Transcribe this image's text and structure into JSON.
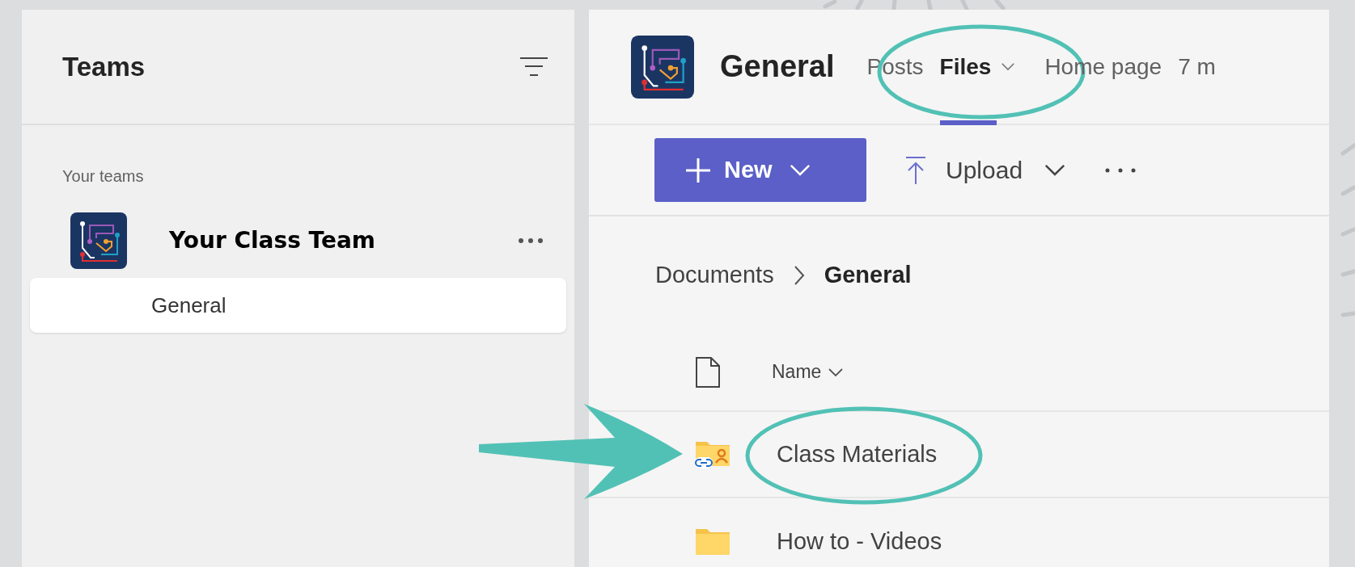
{
  "sidebar": {
    "title": "Teams",
    "section_label": "Your teams",
    "teams": [
      {
        "name": "Your Class Team",
        "channels": [
          {
            "name": "General",
            "selected": true
          }
        ]
      }
    ]
  },
  "channel": {
    "title": "General",
    "tabs": [
      {
        "label": "Posts",
        "selected": false,
        "dropdown": false,
        "circled": false
      },
      {
        "label": "Files",
        "selected": true,
        "dropdown": true,
        "circled": true
      },
      {
        "label": "Home page",
        "selected": false,
        "dropdown": false,
        "circled": false
      },
      {
        "label": "7 m",
        "selected": false,
        "dropdown": false,
        "circled": false
      }
    ]
  },
  "toolbar": {
    "new_label": "New",
    "upload_label": "Upload"
  },
  "breadcrumb": [
    {
      "label": "Documents",
      "current": false
    },
    {
      "label": "General",
      "current": true
    }
  ],
  "file_list": {
    "name_column": "Name",
    "rows": [
      {
        "name": "Class Materials",
        "kind": "shared-folder",
        "circled": true,
        "arrow": true
      },
      {
        "name": "How to - Videos",
        "kind": "folder",
        "circled": false,
        "arrow": false
      }
    ]
  }
}
